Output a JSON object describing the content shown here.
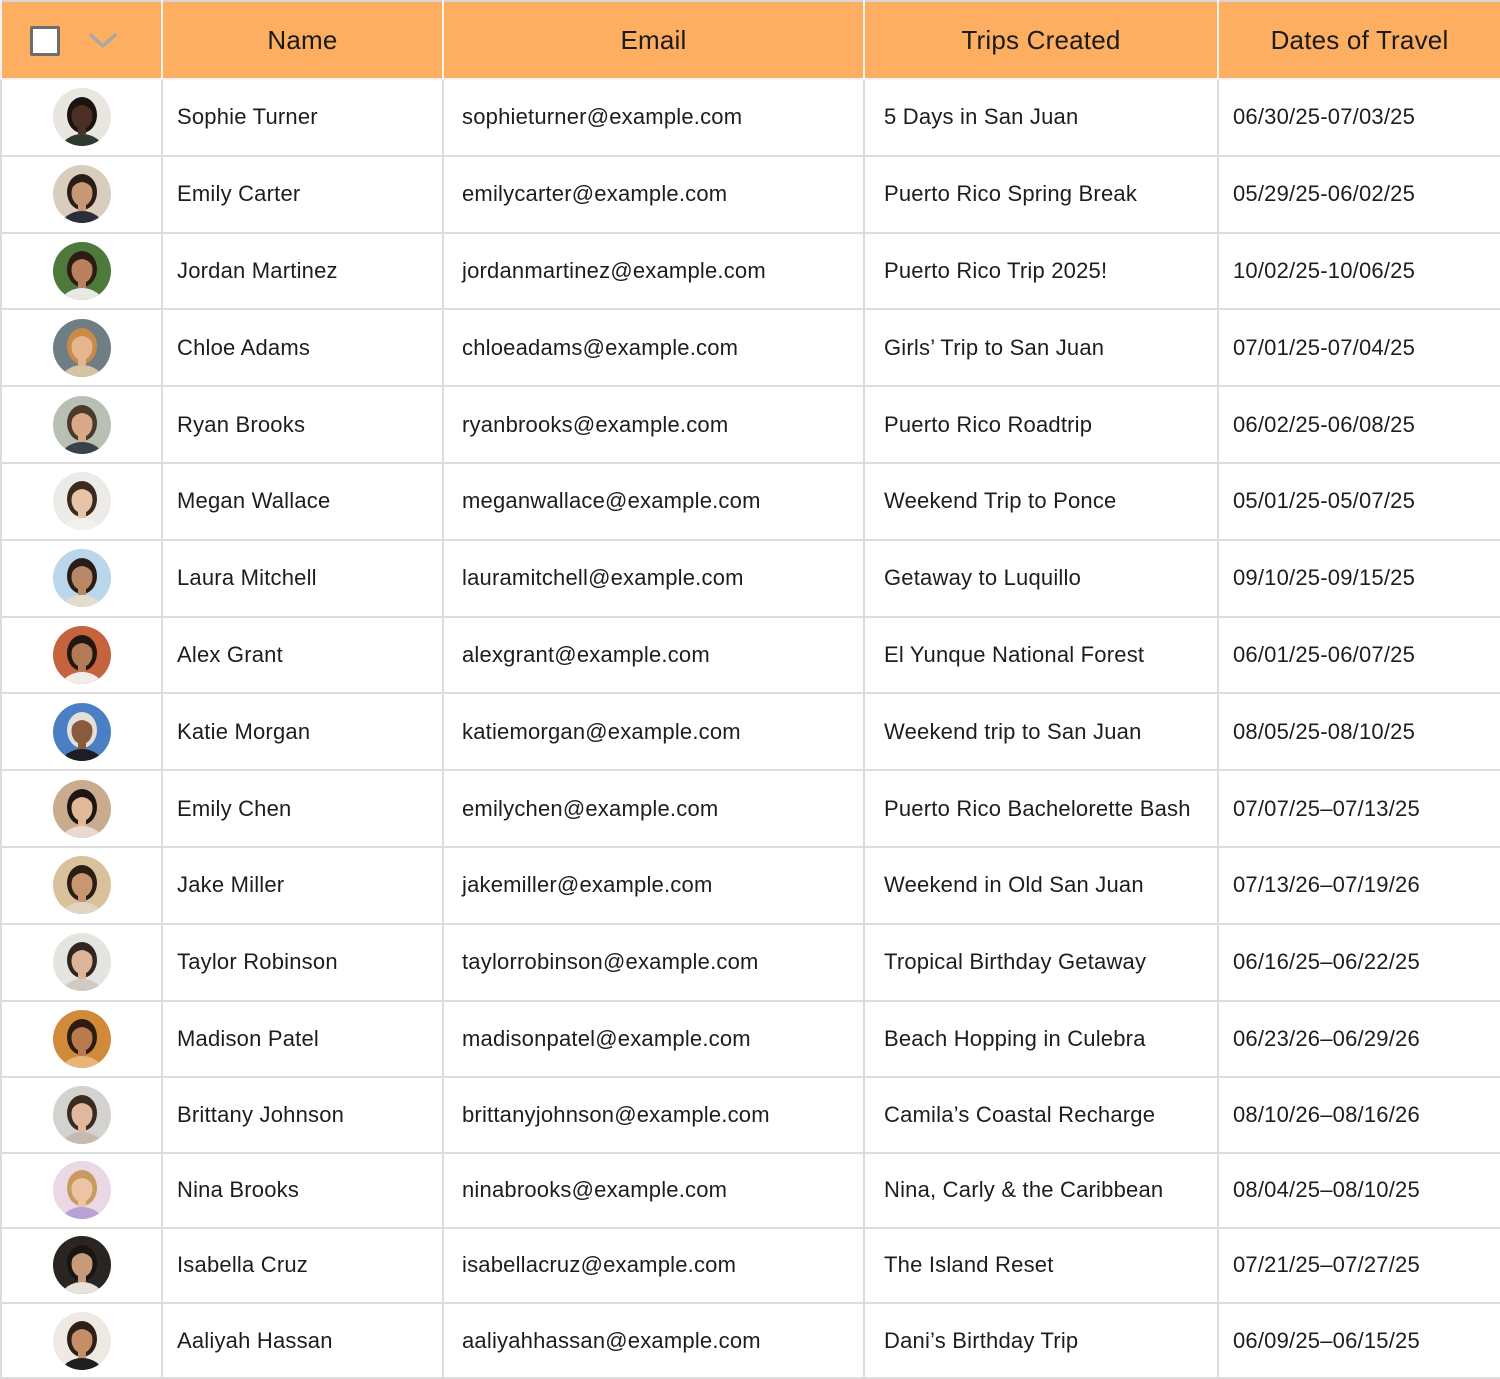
{
  "header": {
    "select_all_icon": "checkbox-empty-icon",
    "dropdown_icon": "chevron-down-icon",
    "columns": [
      "Name",
      "Email",
      "Trips Created",
      "Dates of Travel"
    ]
  },
  "colors": {
    "header_bg": "#fdae61",
    "row_bg": "#ffffff",
    "border": "#dddddd"
  },
  "rows": [
    {
      "name": "Sophie Turner",
      "email": "sophieturner@example.com",
      "trip": "5 Days in San Juan",
      "dates": "06/30/25-07/03/25",
      "avatar": {
        "bg": "#e9e6df",
        "skin": "#4a2f22",
        "hair": "#1a1411",
        "shirt": "#2f3a2e"
      }
    },
    {
      "name": "Emily Carter",
      "email": "emilycarter@example.com",
      "trip": "Puerto Rico Spring Break",
      "dates": "05/29/25-06/02/25",
      "avatar": {
        "bg": "#d9cdbd",
        "skin": "#c79776",
        "hair": "#2a1c16",
        "shirt": "#2b2f3b"
      }
    },
    {
      "name": "Jordan Martinez",
      "email": "jordanmartinez@example.com",
      "trip": "Puerto Rico Trip 2025!",
      "dates": "10/02/25-10/06/25",
      "avatar": {
        "bg": "#4d7a3a",
        "skin": "#b9825c",
        "hair": "#2c1d14",
        "shirt": "#e8e8e4"
      }
    },
    {
      "name": "Chloe Adams",
      "email": "chloeadams@example.com",
      "trip": "Girls’ Trip to San Juan",
      "dates": "07/01/25-07/04/25",
      "avatar": {
        "bg": "#6e7e83",
        "skin": "#e4b58f",
        "hair": "#c98a4a",
        "shirt": "#d6c3a4"
      }
    },
    {
      "name": "Ryan Brooks",
      "email": "ryanbrooks@example.com",
      "trip": "Puerto Rico Roadtrip",
      "dates": "06/02/25-06/08/25",
      "avatar": {
        "bg": "#b8c0b3",
        "skin": "#d9a886",
        "hair": "#4a3a2c",
        "shirt": "#3b4148"
      }
    },
    {
      "name": "Megan Wallace",
      "email": "meganwallace@example.com",
      "trip": "Weekend Trip to Ponce",
      "dates": "05/01/25-05/07/25",
      "avatar": {
        "bg": "#ecebe8",
        "skin": "#e8c4a6",
        "hair": "#3b2a1f",
        "shirt": "#f2f0ec"
      }
    },
    {
      "name": "Laura Mitchell",
      "email": "lauramitchell@example.com",
      "trip": "Getaway to Luquillo",
      "dates": "09/10/25-09/15/25",
      "avatar": {
        "bg": "#b9d6ea",
        "skin": "#b88866",
        "hair": "#2a1d18",
        "shirt": "#e4dccd"
      }
    },
    {
      "name": "Alex Grant",
      "email": "alexgrant@example.com",
      "trip": "El Yunque National Forest",
      "dates": "06/01/25-06/07/25",
      "avatar": {
        "bg": "#c5633f",
        "skin": "#b47a56",
        "hair": "#221611",
        "shirt": "#f1ede8"
      }
    },
    {
      "name": "Katie Morgan",
      "email": "katiemorgan@example.com",
      "trip": "Weekend trip to San Juan",
      "dates": "08/05/25-08/10/25",
      "avatar": {
        "bg": "#4b7fc4",
        "skin": "#8a5a3e",
        "hair": "#e3e0da",
        "shirt": "#1e1e22"
      }
    },
    {
      "name": "Emily Chen",
      "email": "emilychen@example.com",
      "trip": "Puerto Rico Bachelorette Bash",
      "dates": "07/07/25–07/13/25",
      "avatar": {
        "bg": "#c9ab8e",
        "skin": "#e2b898",
        "hair": "#1d1613",
        "shirt": "#e9d9cf"
      }
    },
    {
      "name": "Jake Miller",
      "email": "jakemiller@example.com",
      "trip": "Weekend in Old San Juan",
      "dates": "07/13/26–07/19/26",
      "avatar": {
        "bg": "#d9c19c",
        "skin": "#c89670",
        "hair": "#2b1d14",
        "shirt": "#e0d5c2"
      }
    },
    {
      "name": "Taylor Robinson",
      "email": "taylorrobinson@example.com",
      "trip": "Tropical Birthday Getaway",
      "dates": "06/16/25–06/22/25",
      "avatar": {
        "bg": "#e6e4e0",
        "skin": "#dcb497",
        "hair": "#2f2620",
        "shirt": "#cfcac3"
      }
    },
    {
      "name": "Madison Patel",
      "email": "madisonpatel@example.com",
      "trip": "Beach Hopping in Culebra",
      "dates": "06/23/26–06/29/26",
      "avatar": {
        "bg": "#d08a3a",
        "skin": "#b97b4e",
        "hair": "#2d1c12",
        "shirt": "#e7b676"
      }
    },
    {
      "name": "Brittany Johnson",
      "email": "brittanyjohnson@example.com",
      "trip": "Camila’s Coastal Recharge",
      "dates": "08/10/26–08/16/26",
      "avatar": {
        "bg": "#d4d2cf",
        "skin": "#e0b99c",
        "hair": "#3a2a21",
        "shirt": "#c6b9ad"
      }
    },
    {
      "name": "Nina Brooks",
      "email": "ninabrooks@example.com",
      "trip": "Nina, Carly & the Caribbean",
      "dates": "08/04/25–08/10/25",
      "avatar": {
        "bg": "#ead8e4",
        "skin": "#ecc3a3",
        "hair": "#c89a5e",
        "shirt": "#b9a0d6"
      }
    },
    {
      "name": "Isabella Cruz",
      "email": "isabellacruz@example.com",
      "trip": "The Island Reset",
      "dates": "07/21/25–07/27/25",
      "avatar": {
        "bg": "#2a2522",
        "skin": "#c89a7c",
        "hair": "#1a1412",
        "shirt": "#e8e2db"
      }
    },
    {
      "name": "Aaliyah Hassan",
      "email": "aaliyahhassan@example.com",
      "trip": "Dani’s Birthday Trip",
      "dates": "06/09/25–06/15/25",
      "avatar": {
        "bg": "#efe9e3",
        "skin": "#c58d68",
        "hair": "#2e1f17",
        "shirt": "#1f1f22"
      }
    }
  ]
}
